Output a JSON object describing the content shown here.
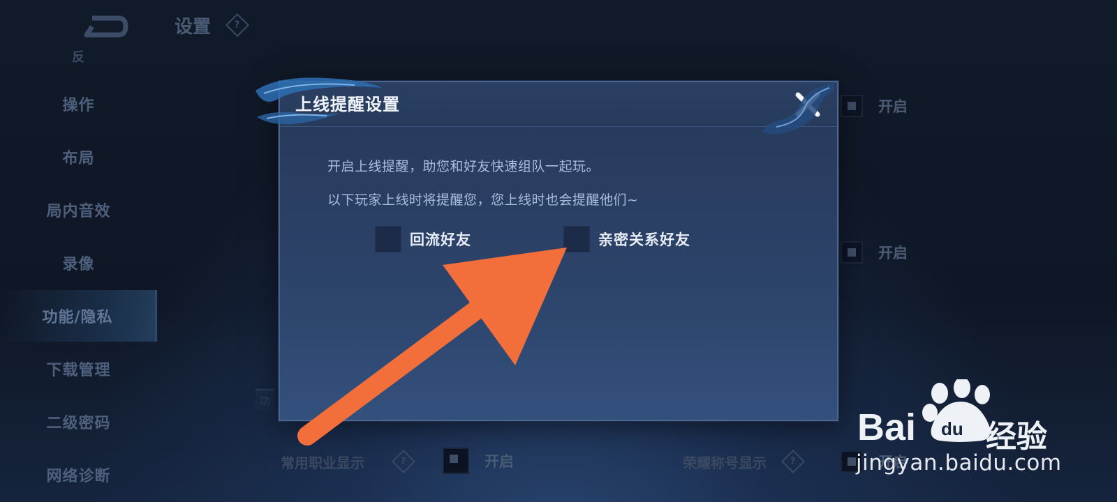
{
  "sidebar": {
    "partial_item": "反",
    "items": [
      {
        "label": "操作"
      },
      {
        "label": "布局"
      },
      {
        "label": "局内音效"
      },
      {
        "label": "录像"
      },
      {
        "label": "功能/隐私"
      },
      {
        "label": "下载管理"
      },
      {
        "label": "二级密码"
      },
      {
        "label": "网络诊断"
      }
    ],
    "active_index": 4
  },
  "header": {
    "title": "设置"
  },
  "background": {
    "toggle_label_1": "开启",
    "toggle_label_2": "开启",
    "row_left_label": "常用职业显示",
    "row_left_toggle": "开启",
    "row_right_label": "荣耀称号显示",
    "row_right_toggle": "开启",
    "fragment": "功"
  },
  "modal": {
    "title": "上线提醒设置",
    "line1": "开启上线提醒，助您和好友快速组队一起玩。",
    "line2": "以下玩家上线时将提醒您，您上线时也会提醒他们~",
    "options": [
      {
        "label": "回流好友",
        "checked": false
      },
      {
        "label": "亲密关系好友",
        "checked": false
      }
    ]
  },
  "annotation": {
    "arrow_color": "#f26f3c"
  },
  "watermark": {
    "brand": "Bai",
    "brand_tail": "经验",
    "url": "jingyan.baidu.com",
    "paw_text": "du"
  }
}
